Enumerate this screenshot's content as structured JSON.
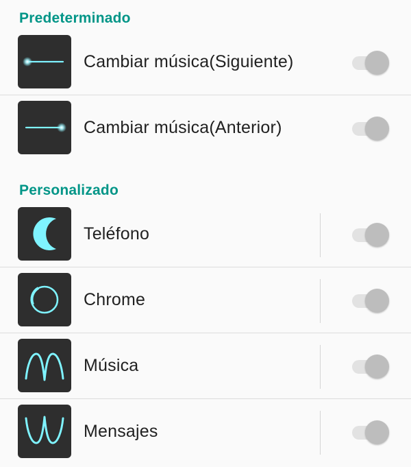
{
  "sections": [
    {
      "title": "Predeterminado",
      "items": [
        {
          "label": "Cambiar música(Siguiente)",
          "gesture_icon": "swipe-right-gesture-icon",
          "enabled": false
        },
        {
          "label": "Cambiar música(Anterior)",
          "gesture_icon": "swipe-left-gesture-icon",
          "enabled": false
        }
      ]
    },
    {
      "title": "Personalizado",
      "items": [
        {
          "label": "Teléfono",
          "gesture_icon": "c-gesture-icon",
          "enabled": false
        },
        {
          "label": "Chrome",
          "gesture_icon": "o-gesture-icon",
          "enabled": false
        },
        {
          "label": "Música",
          "gesture_icon": "m-gesture-icon",
          "enabled": false
        },
        {
          "label": "Mensajes",
          "gesture_icon": "w-gesture-icon",
          "enabled": false
        }
      ]
    }
  ],
  "colors": {
    "accent": "#009587",
    "gesture_stroke": "#7ff3ff",
    "thumb_background": "#2e2e2e",
    "switch_track_off": "#e2e2e2",
    "switch_knob_off": "#bdbdbd"
  }
}
